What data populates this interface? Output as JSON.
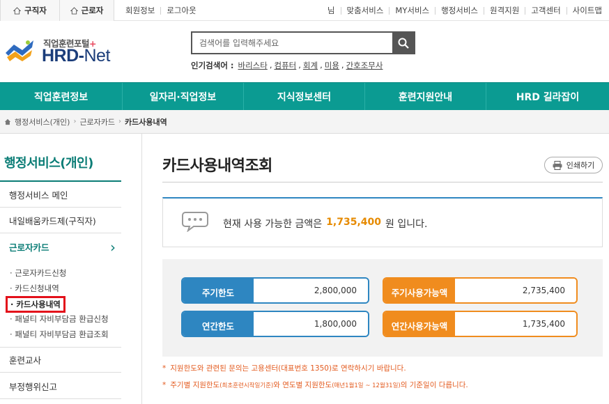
{
  "topbar": {
    "tabs": [
      {
        "label": "구직자",
        "icon": "home-icon"
      },
      {
        "label": "근로자",
        "icon": "home-icon"
      }
    ],
    "member_links": [
      "회원정보",
      "로그아웃"
    ],
    "user_suffix": "님",
    "util_links": [
      "맞춤서비스",
      "MY서비스",
      "행정서비스",
      "원격지원",
      "고객센터",
      "사이트맵"
    ]
  },
  "logo": {
    "sub": "직업훈련포털",
    "plus": "+",
    "main": "HRD-",
    "main_suffix": "Net"
  },
  "search": {
    "placeholder": "검색어를 입력해주세요",
    "popular_label": "인기검색어 :",
    "popular_terms": [
      "바리스타",
      "컴퓨터",
      "회계",
      "미용",
      "간호조무사"
    ]
  },
  "gnb": [
    "직업훈련정보",
    "일자리·직업정보",
    "지식정보센터",
    "훈련지원안내",
    "HRD 길라잡이"
  ],
  "breadcrumb": [
    "행정서비스(개인)",
    "근로자카드",
    "카드사용내역"
  ],
  "sidebar": {
    "title": "행정서비스(개인)",
    "items": [
      "행정서비스 메인",
      "내일배움카드제(구직자)",
      "근로자카드"
    ],
    "active_arrow": "›",
    "sub_items": [
      "· 근로자카드신청",
      "· 카드신청내역",
      "· 카드사용내역",
      "· 패널티 자비부담금 환급신청",
      "· 패널티 자비부담금 환급조회"
    ],
    "bottom_items": [
      "훈련교사",
      "부정행위신고"
    ]
  },
  "main": {
    "title": "카드사용내역조회",
    "print_label": "인쇄하기",
    "balance_prefix": "현재 사용 가능한 금액은",
    "balance_amount": "1,735,400",
    "balance_suffix": "원 입니다.",
    "limits": [
      {
        "label": "주기한도",
        "value": "2,800,000",
        "color": "#2e86c1"
      },
      {
        "label": "주기사용가능액",
        "value": "2,735,400",
        "color": "#f08c1e"
      },
      {
        "label": "연간한도",
        "value": "1,800,000",
        "color": "#2e86c1"
      },
      {
        "label": "연간사용가능액",
        "value": "1,735,400",
        "color": "#f08c1e"
      }
    ],
    "notes": [
      {
        "star": "*",
        "text": "지원한도와 관련된 문의는 고용센터(대표번호 1350)로 연락하시기 바랍니다."
      },
      {
        "star": "*",
        "text_a": "주기별 지원한도",
        "text_b": "(최초훈련시작일기준)",
        "text_c": "와 연도별 지원한도",
        "text_d": "(매년1월1일 ~ 12월31일)",
        "text_e": "의 기준일이 다릅니다."
      }
    ]
  }
}
